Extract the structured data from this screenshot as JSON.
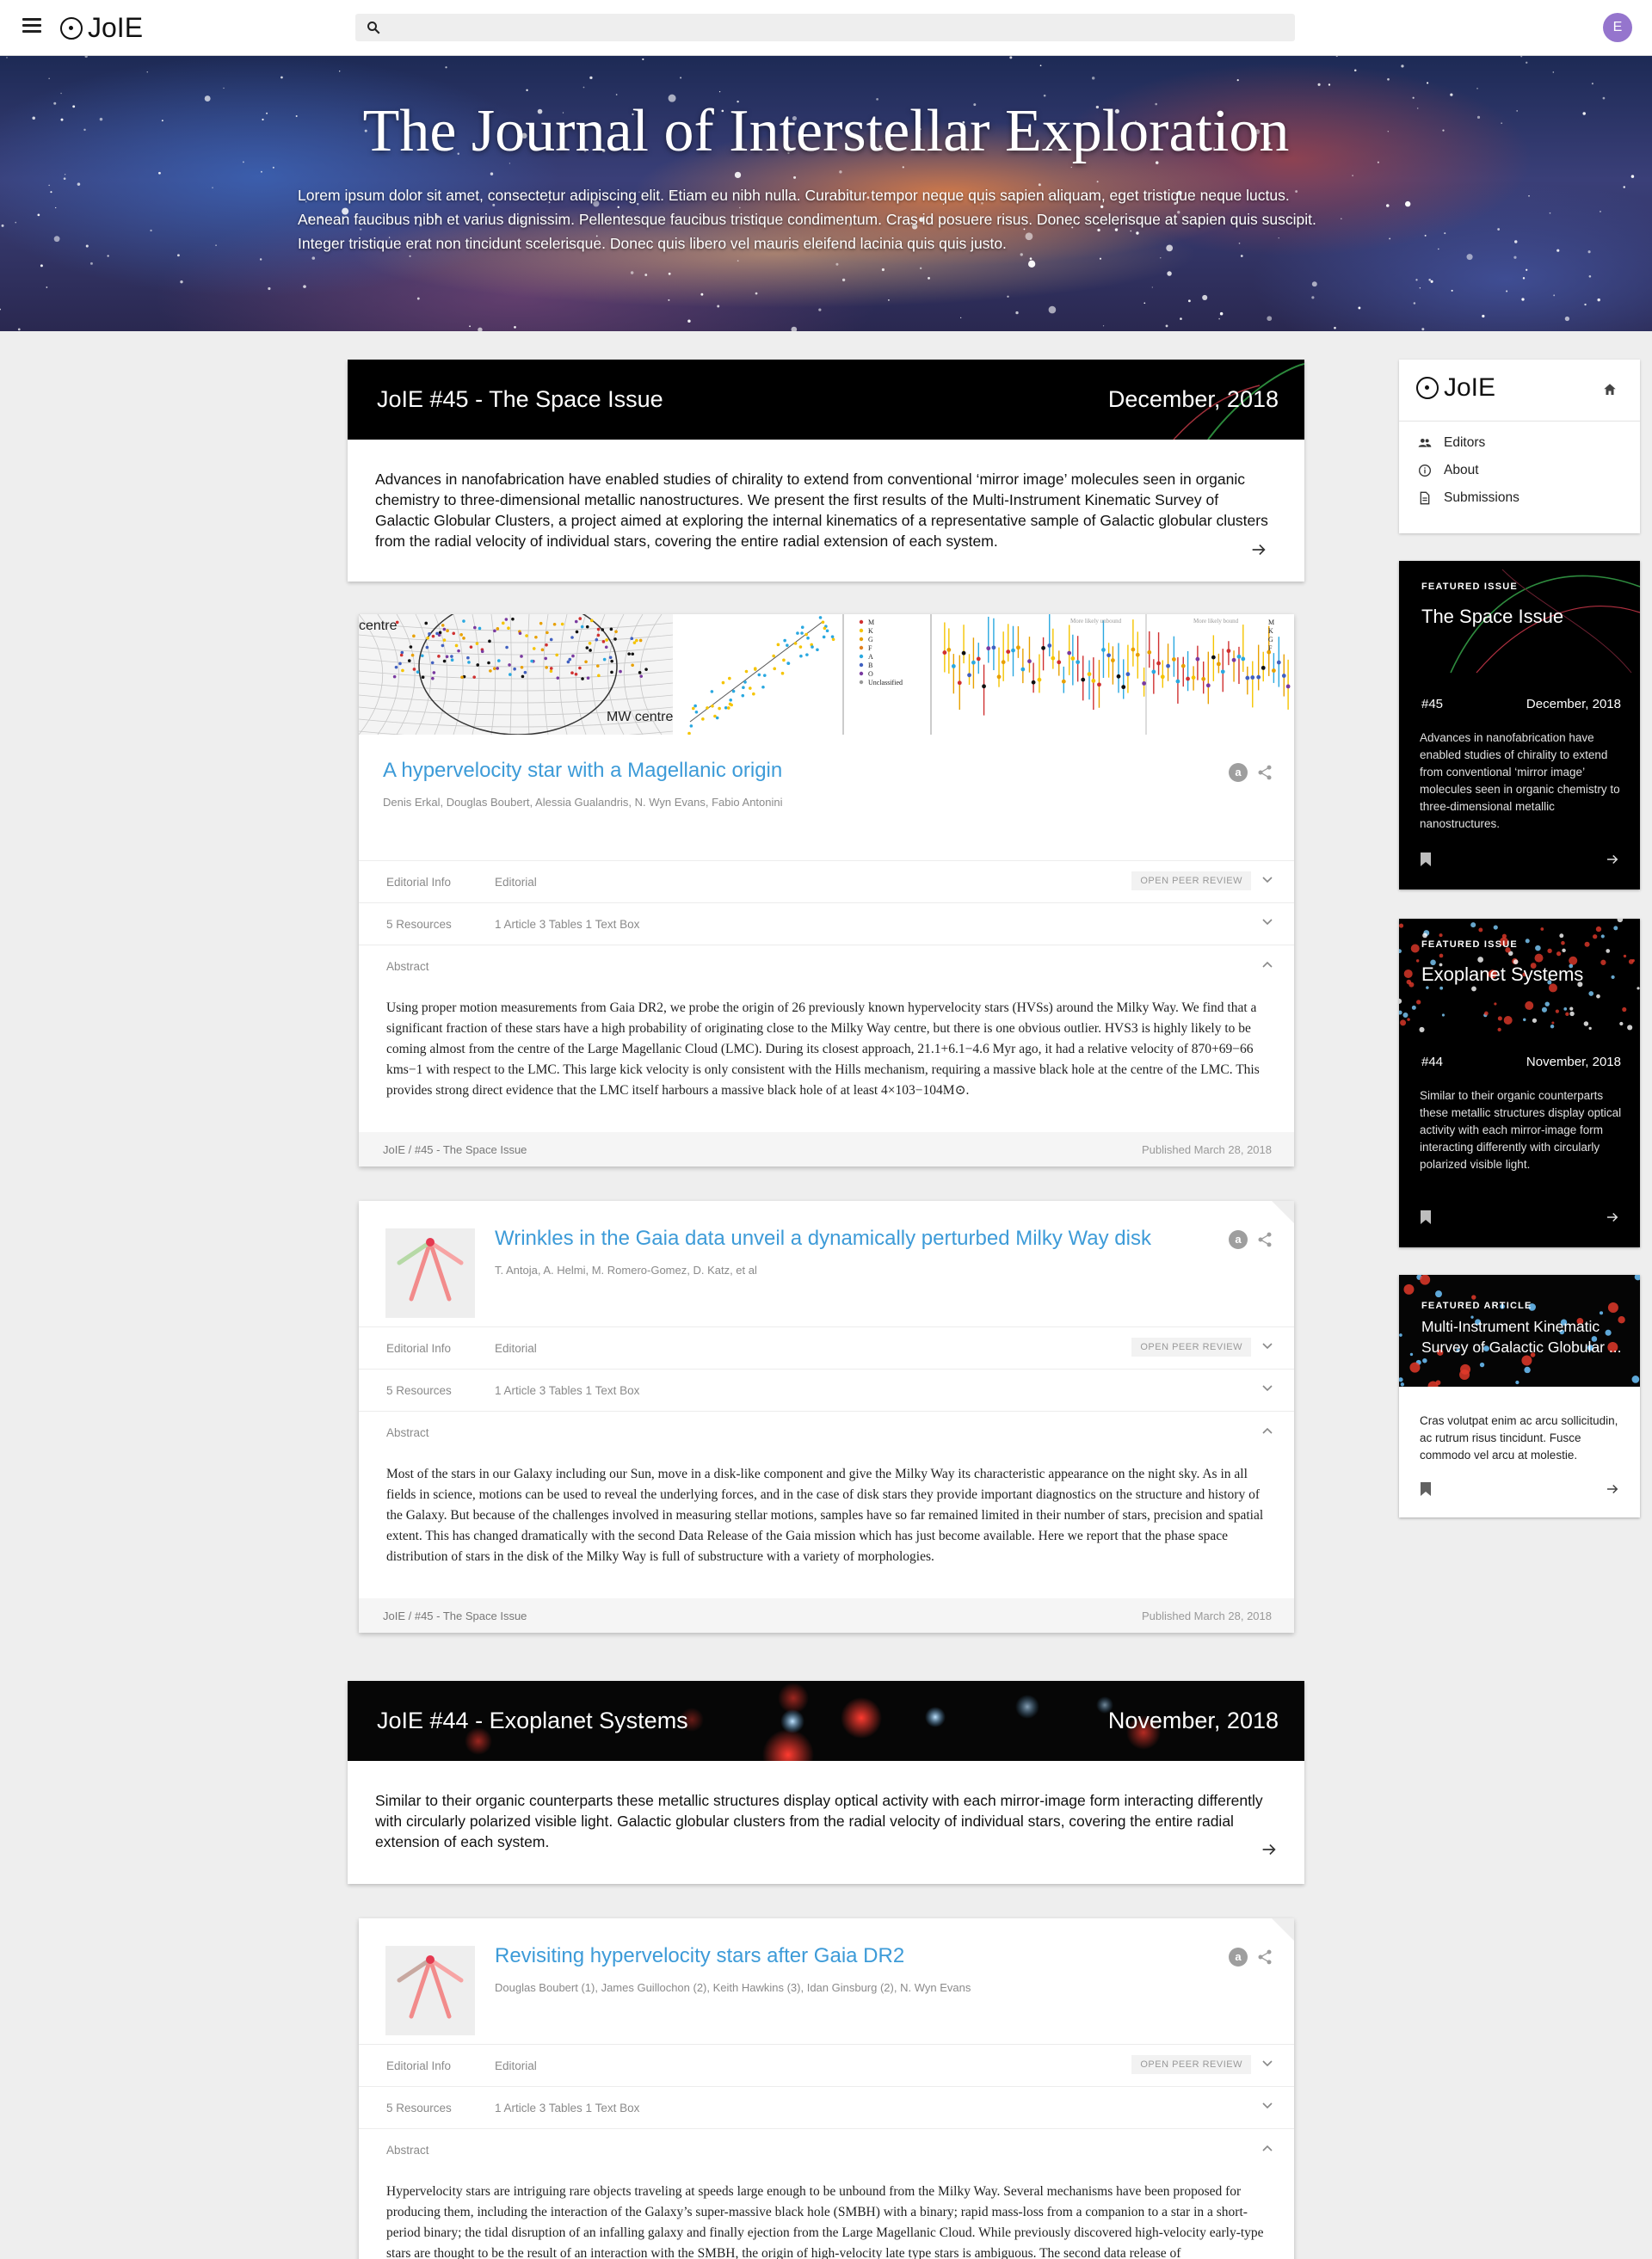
{
  "app": {
    "logo_text": "JoIE",
    "search_placeholder": "",
    "avatar_initial": "E"
  },
  "hero": {
    "title": "The Journal of Interstellar Exploration",
    "description": "Lorem ipsum dolor sit amet, consectetur adipiscing elit. Etiam eu nibh nulla. Curabitur tempor neque quis sapien aliquam, eget tristique neque luctus. Aenean faucibus nibh et varius dignissim. Pellentesque faucibus tristique condimentum. Cras id posuere risus. Donec scelerisque at sapien quis suscipit. Integer tristique erat non tincidunt scelerisque. Donec quis libero vel mauris eleifend lacinia quis quis justo."
  },
  "issues": [
    {
      "name": "JoIE #45 - The Space Issue",
      "date": "December, 2018",
      "summary": "Advances in nanofabrication have enabled studies of chirality to extend from conventional ‘mirror image’ molecules seen in organic chemistry to three-dimensional metallic nanostructures. We present the first results of the Multi-Instrument Kinematic Survey of Galactic Globular Clusters, a project aimed at exploring the internal kinematics of a representative sample of Galactic globular clusters from the radial velocity of individual stars, covering the entire radial extension of each system."
    },
    {
      "name": "JoIE #44 - Exoplanet Systems",
      "date": "November, 2018",
      "summary": "Similar to their organic counterparts these metallic structures display optical activity with each mirror-image form interacting differently with circularly polarized visible light. Galactic globular clusters from the radial velocity of individual stars, covering the entire radial extension of each system."
    }
  ],
  "articles": [
    {
      "title": "A hypervelocity star with a Magellanic origin",
      "authors": "Denis Erkal, Douglas Boubert, Alessia Gualandris, N. Wyn Evans, Fabio Antonini",
      "editorial_label": "Editorial Info",
      "editorial_value": "Editorial",
      "peer_review": "OPEN PEER REVIEW",
      "resources_label": "5 Resources",
      "resources_value": "1 Article  3 Tables  1 Text Box",
      "abstract_label": "Abstract",
      "abstract": "Using proper motion measurements from Gaia DR2, we probe the origin of 26 previously known hypervelocity stars (HVSs) around the Milky Way. We find that a significant fraction of these stars have a high probability of originating close to the Milky Way centre, but there is one obvious outlier. HVS3 is highly likely to be coming almost from the centre of the Large Magellanic Cloud (LMC). During its closest approach, 21.1+6.1−4.6 Myr ago, it had a relative velocity of 870+69−66 kms−1 with respect to the LMC. This large kick velocity is only consistent with the Hills mechanism, requiring a massive black hole at the centre of the LMC. This provides strong direct evidence that the LMC itself harbours a massive black hole of at least 4×103−104M⊙.",
      "issue_link": "JoIE / #45 - The Space Issue",
      "published": "Published March 28, 2018",
      "figure_labels": [
        "centre",
        "MW centre",
        "M",
        "K",
        "G",
        "F",
        "A",
        "B",
        "O",
        "Unclassified",
        "More likely unbound",
        "More likely bound",
        "M",
        "K",
        "G",
        "F"
      ]
    },
    {
      "title": "Wrinkles in the Gaia data unveil a dynamically perturbed Milky Way disk",
      "authors": "T. Antoja, A. Helmi, M. Romero-Gomez, D. Katz, et al",
      "editorial_label": "Editorial Info",
      "editorial_value": "Editorial",
      "peer_review": "OPEN PEER REVIEW",
      "resources_label": "5 Resources",
      "resources_value": "1 Article  3 Tables  1 Text Box",
      "abstract_label": "Abstract",
      "abstract": "Most of the stars in our Galaxy including our Sun, move in a disk-like component and give the Milky Way its characteristic appearance on the night sky. As in all fields in science, motions can be used to reveal the underlying forces, and in the case of disk stars they provide important diagnostics on the structure and history of the Galaxy. But because of the challenges involved in measuring stellar motions, samples have so far remained limited in their number of stars, precision and spatial extent. This has changed dramatically with the second Data Release of the Gaia mission which has just become available. Here we report that the phase space distribution of stars in the disk of the Milky Way is full of substructure with a variety of morphologies.",
      "issue_link": "JoIE / #45 - The Space Issue",
      "published": "Published March 28, 2018"
    },
    {
      "title": "Revisiting hypervelocity stars after Gaia DR2",
      "authors": "Douglas Boubert (1), James Guillochon (2), Keith Hawkins (3), Idan Ginsburg (2), N. Wyn Evans",
      "editorial_label": "Editorial Info",
      "editorial_value": "Editorial",
      "peer_review": "OPEN PEER REVIEW",
      "resources_label": "5 Resources",
      "resources_value": "1 Article  3 Tables  1 Text Box",
      "abstract_label": "Abstract",
      "abstract": "Hypervelocity stars are intriguing rare objects traveling at speeds large enough to be unbound from the Milky Way. Several mechanisms have been proposed for producing them, including the interaction of the Galaxy’s super-massive black hole (SMBH) with a binary; rapid mass-loss from a companion to a star in a short-period binary; the tidal disruption of an infalling galaxy and finally ejection from the Large Magellanic Cloud. While previously discovered high-velocity early-type stars are thought to be the result of an interaction with the SMBH, the origin of high-velocity late type stars is ambiguous. The second data release of"
    }
  ],
  "sidebar": {
    "nav": [
      "Editors",
      "About",
      "Submissions"
    ],
    "featured": [
      {
        "kicker": "FEATURED ISSUE",
        "title": "The Space Issue",
        "number": "#45",
        "date": "December, 2018",
        "description": "Advances in nanofabrication have enabled studies of chirality to extend from conventional ‘mirror image’ molecules seen in organic chemistry to three-dimensional metallic nanostructures."
      },
      {
        "kicker": "FEATURED ISSUE",
        "title": "Exoplanet Systems",
        "number": "#44",
        "date": "November, 2018",
        "description": "Similar to their organic counterparts these metallic structures display optical activity with each mirror-image form interacting differently with circularly polarized visible light."
      },
      {
        "kicker": "FEATURED ARTICLE",
        "title": "Multi-Instrument Kinematic Survey of Galactic Globular ...",
        "description": "Cras volutpat enim ac arcu sollicitudin, ac rutrum risus tincidunt. Fusce commodo vel arcu at molestie."
      }
    ]
  },
  "colors": {
    "link": "#3d9bd8",
    "avatar": "#9575cd",
    "background": "#eeeeee"
  }
}
